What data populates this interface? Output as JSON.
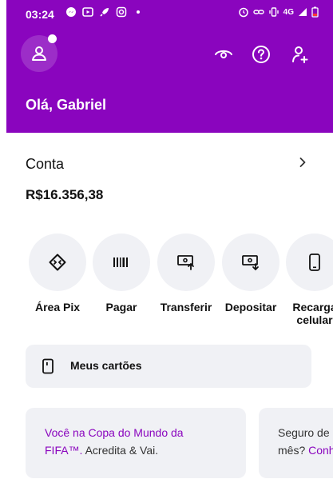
{
  "status_bar": {
    "time": "03:24",
    "network": "4G"
  },
  "header": {
    "greeting": "Olá, Gabriel",
    "icons": [
      "person-icon",
      "eye-icon",
      "help-icon",
      "add-person-icon"
    ]
  },
  "account": {
    "title": "Conta",
    "balance": "R$16.356,38"
  },
  "actions": [
    {
      "label": "Área Pix",
      "icon": "pix-icon"
    },
    {
      "label": "Pagar",
      "icon": "barcode-icon"
    },
    {
      "label": "Transferir",
      "icon": "transfer-icon"
    },
    {
      "label": "Depositar",
      "icon": "deposit-icon"
    },
    {
      "label": "Recarga\ncelular",
      "icon": "phone-icon"
    }
  ],
  "cards": {
    "label": "Meus cartões"
  },
  "promos": [
    {
      "line1_link": "Você na Copa do Mundo da",
      "line2_link": "FIFA™.",
      "line2_rest": " Acredita & Vai."
    },
    {
      "line1": "Seguro de",
      "line2_rest": "mês? ",
      "line2_link": "Conh"
    }
  ],
  "colors": {
    "brand": "#8a05be",
    "surface": "#f0f1f5"
  }
}
